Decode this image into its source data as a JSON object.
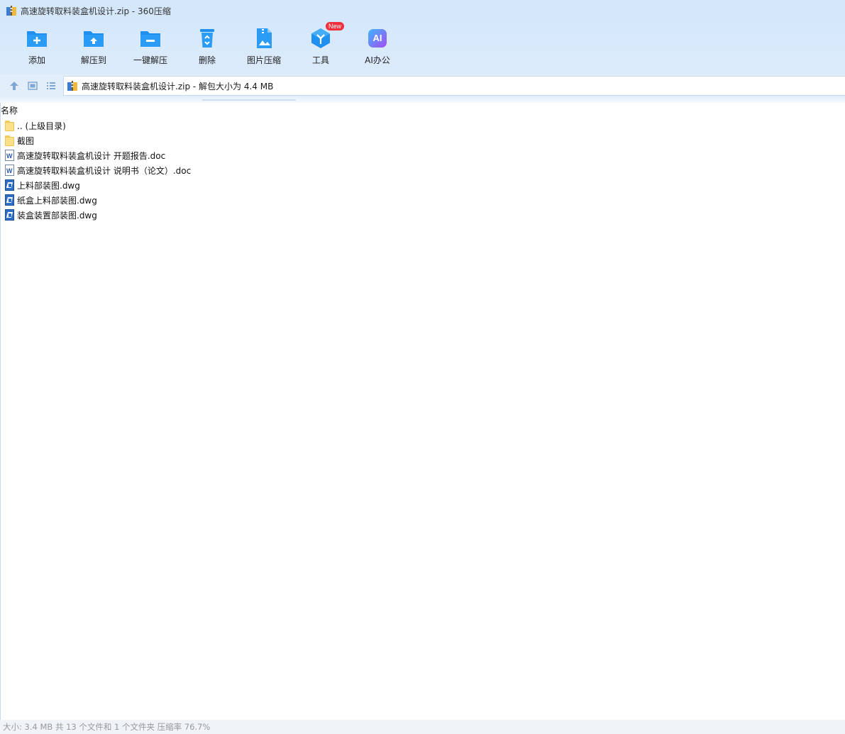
{
  "window": {
    "title": "高速旋转取料装盒机设计.zip - 360压缩"
  },
  "toolbar": {
    "items": [
      {
        "label": "添加",
        "icon": "add-folder-icon"
      },
      {
        "label": "解压到",
        "icon": "extract-to-icon"
      },
      {
        "label": "一键解压",
        "icon": "one-click-extract-icon"
      },
      {
        "label": "删除",
        "icon": "delete-icon"
      },
      {
        "label": "图片压缩",
        "icon": "image-compress-icon"
      },
      {
        "label": "工具",
        "icon": "tools-icon",
        "badge": "New"
      },
      {
        "label": "AI办公",
        "icon": "ai-office-icon",
        "glyph": "AI"
      }
    ]
  },
  "address": {
    "path": "高速旋转取料装盒机设计.zip - 解包大小为 4.4 MB"
  },
  "list": {
    "column_name": "名称",
    "files": [
      {
        "name": ".. (上级目录)",
        "type": "folder"
      },
      {
        "name": "截图",
        "type": "folder"
      },
      {
        "name": "高速旋转取料装盒机设计 开题报告.doc",
        "type": "doc"
      },
      {
        "name": "高速旋转取料装盒机设计 说明书（论文）.doc",
        "type": "doc"
      },
      {
        "name": "上料部装图.dwg",
        "type": "dwg"
      },
      {
        "name": "纸盒上料部装图.dwg",
        "type": "dwg"
      },
      {
        "name": "装盒装置部装图.dwg",
        "type": "dwg"
      }
    ]
  },
  "status": {
    "text": "大小: 3.4 MB 共 13 个文件和 1 个文件夹 压缩率 76.7%"
  },
  "colors": {
    "accent": "#1e88e5",
    "toolbar_bg": "#d5e8fb",
    "badge": "#f2303d"
  }
}
